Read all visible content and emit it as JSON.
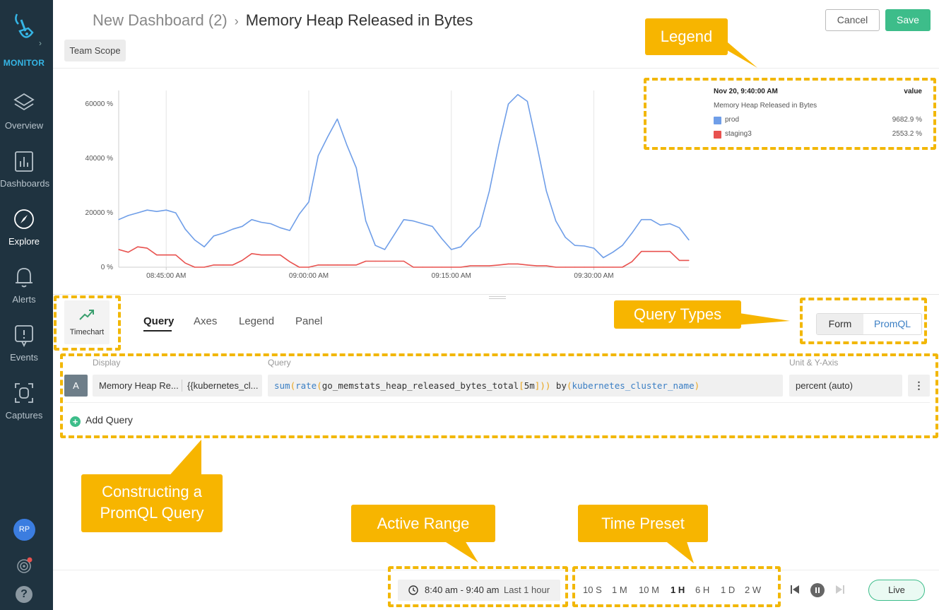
{
  "app": {
    "brand": "MONITOR",
    "nav": [
      {
        "label": "Overview",
        "icon": "layers-icon",
        "active": false
      },
      {
        "label": "Dashboards",
        "icon": "bar-chart-icon",
        "active": false
      },
      {
        "label": "Explore",
        "icon": "compass-icon",
        "active": true
      },
      {
        "label": "Alerts",
        "icon": "bell-icon",
        "active": false
      },
      {
        "label": "Events",
        "icon": "events-icon",
        "active": false
      },
      {
        "label": "Captures",
        "icon": "capture-icon",
        "active": false
      }
    ],
    "user_initials": "RP",
    "help": "?"
  },
  "header": {
    "breadcrumb_parent": "New Dashboard (2)",
    "breadcrumb_current": "Memory Heap Released in Bytes",
    "cancel_label": "Cancel",
    "save_label": "Save",
    "scope_label": "Team Scope"
  },
  "legend_panel": {
    "timestamp": "Nov 20, 9:40:00 AM",
    "value_header": "value",
    "metric_name": "Memory Heap Released in Bytes",
    "rows": [
      {
        "name": "prod",
        "value": "9682.9 %",
        "color": "#6f9ee8"
      },
      {
        "name": "staging3",
        "value": "2553.2 %",
        "color": "#e8524f"
      }
    ]
  },
  "chart_data": {
    "type": "line",
    "y_ticks": [
      "0 %",
      "20000 %",
      "40000 %",
      "60000 %"
    ],
    "ylim": [
      0,
      65000
    ],
    "x_ticks": [
      "08:45:00 AM",
      "09:00:00 AM",
      "09:15:00 AM",
      "09:30:00 AM"
    ],
    "x_range": [
      "08:40",
      "09:40"
    ],
    "grid": "vertical",
    "series": [
      {
        "name": "prod",
        "color": "#6f9ee8",
        "values": [
          17500,
          19000,
          20000,
          21000,
          20500,
          21000,
          20000,
          14000,
          10000,
          7500,
          11500,
          12500,
          14000,
          15000,
          17500,
          16500,
          16000,
          14500,
          13500,
          19500,
          24000,
          41000,
          48000,
          54500,
          45000,
          36500,
          17000,
          8000,
          6500,
          12000,
          17500,
          17000,
          16000,
          15000,
          10500,
          6500,
          7500,
          11500,
          15000,
          28000,
          45000,
          60000,
          63500,
          61000,
          45000,
          28000,
          17000,
          11000,
          8000,
          7800,
          7000,
          3500,
          5500,
          8000,
          12500,
          17500,
          17500,
          15500,
          16000,
          14500,
          10000
        ]
      },
      {
        "name": "staging3",
        "color": "#e8524f",
        "values": [
          6500,
          5500,
          7500,
          7000,
          4500,
          4500,
          4500,
          1500,
          0,
          0,
          800,
          800,
          800,
          2500,
          5000,
          4500,
          4500,
          4500,
          2000,
          0,
          0,
          800,
          800,
          800,
          800,
          800,
          2200,
          2200,
          2200,
          2200,
          2200,
          0,
          0,
          0,
          0,
          0,
          0,
          500,
          500,
          500,
          800,
          1200,
          1200,
          800,
          500,
          500,
          0,
          0,
          0,
          0,
          0,
          0,
          0,
          0,
          2000,
          5800,
          5800,
          5800,
          5800,
          2500,
          2500
        ]
      }
    ]
  },
  "editor": {
    "chart_type_label": "Timechart",
    "tabs": [
      "Query",
      "Axes",
      "Legend",
      "Panel"
    ],
    "active_tab": "Query",
    "query_types": {
      "form": "Form",
      "promql": "PromQL",
      "active": "Form"
    },
    "columns": {
      "display": "Display",
      "query": "Query",
      "unit": "Unit & Y-Axis"
    },
    "query": {
      "letter": "A",
      "display_name": "Memory Heap Re...",
      "display_alias": "{{kubernetes_cl...",
      "tokens": [
        {
          "t": "sum",
          "k": "fn"
        },
        {
          "t": "(",
          "k": "br"
        },
        {
          "t": "rate",
          "k": "fn"
        },
        {
          "t": "(",
          "k": "br"
        },
        {
          "t": "go_memstats_heap_released_bytes_total",
          "k": "id"
        },
        {
          "t": "[",
          "k": "br"
        },
        {
          "t": "5m",
          "k": "id"
        },
        {
          "t": "]",
          "k": "br"
        },
        {
          "t": ")",
          "k": "br"
        },
        {
          "t": ")",
          "k": "br"
        },
        {
          "t": " by",
          "k": "id"
        },
        {
          "t": "(",
          "k": "br"
        },
        {
          "t": "kubernetes_cluster_name",
          "k": "lb"
        },
        {
          "t": ")",
          "k": "br"
        }
      ],
      "unit": "percent (auto)"
    },
    "add_query_label": "Add Query"
  },
  "time": {
    "range": "8:40 am - 9:40 am",
    "relative": "Last 1 hour",
    "presets": [
      "10 S",
      "1 M",
      "10 M",
      "1 H",
      "6 H",
      "1 D",
      "2 W"
    ],
    "active_preset": "1 H",
    "live_label": "Live"
  },
  "annotations": {
    "legend": "Legend",
    "query_types": "Query Types",
    "constructing_line1": "Constructing a",
    "constructing_line2": "PromQL Query",
    "active_range": "Active Range",
    "time_preset": "Time Preset",
    "highlight_color": "#f2b705",
    "callout_color": "#f7b500"
  }
}
